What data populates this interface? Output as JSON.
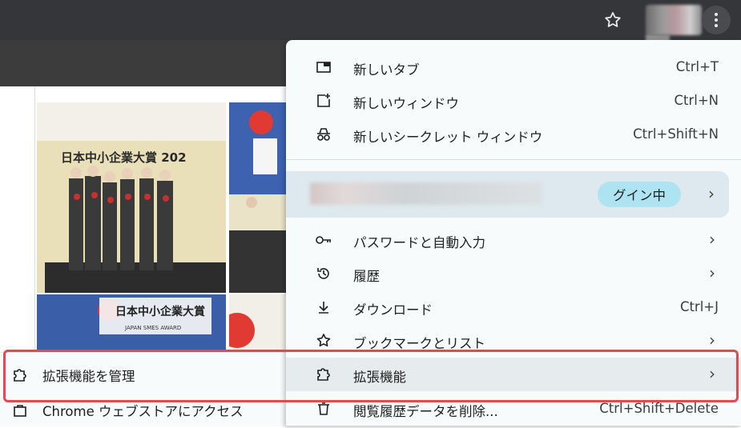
{
  "toolbar": {
    "bookmark_icon": "star-icon",
    "menu_icon": "kebab-icon"
  },
  "left_panel": {
    "items": [
      {
        "label": "拡張機能を管理",
        "icon": "puzzle-icon"
      },
      {
        "label": "Chrome ウェブストアにアクセス",
        "icon": "webstore-icon"
      }
    ]
  },
  "menu": {
    "new_tab": {
      "label": "新しいタブ",
      "shortcut": "Ctrl+T"
    },
    "new_window": {
      "label": "新しいウィンドウ",
      "shortcut": "Ctrl+N"
    },
    "new_incognito": {
      "label": "新しいシークレット ウィンドウ",
      "shortcut": "Ctrl+Shift+N"
    },
    "profile": {
      "status": "グイン中"
    },
    "passwords": {
      "label": "パスワードと自動入力"
    },
    "history": {
      "label": "履歴"
    },
    "downloads": {
      "label": "ダウンロード",
      "shortcut": "Ctrl+J"
    },
    "bookmarks": {
      "label": "ブックマークとリスト"
    },
    "extensions": {
      "label": "拡張機能"
    },
    "clear_data": {
      "label": "閲覧履歴データを削除...",
      "shortcut": "Ctrl+Shift+Delete"
    }
  },
  "photos": {
    "award_banner_text": "日本中小企業大賞 202",
    "award_logo_text": "日本中小企業大賞",
    "award_logo_subtext": "JAPAN SMES AWARD"
  },
  "colors": {
    "highlight": "#e5484d",
    "chip": "#aee4f2",
    "topbar": "#35363a"
  }
}
